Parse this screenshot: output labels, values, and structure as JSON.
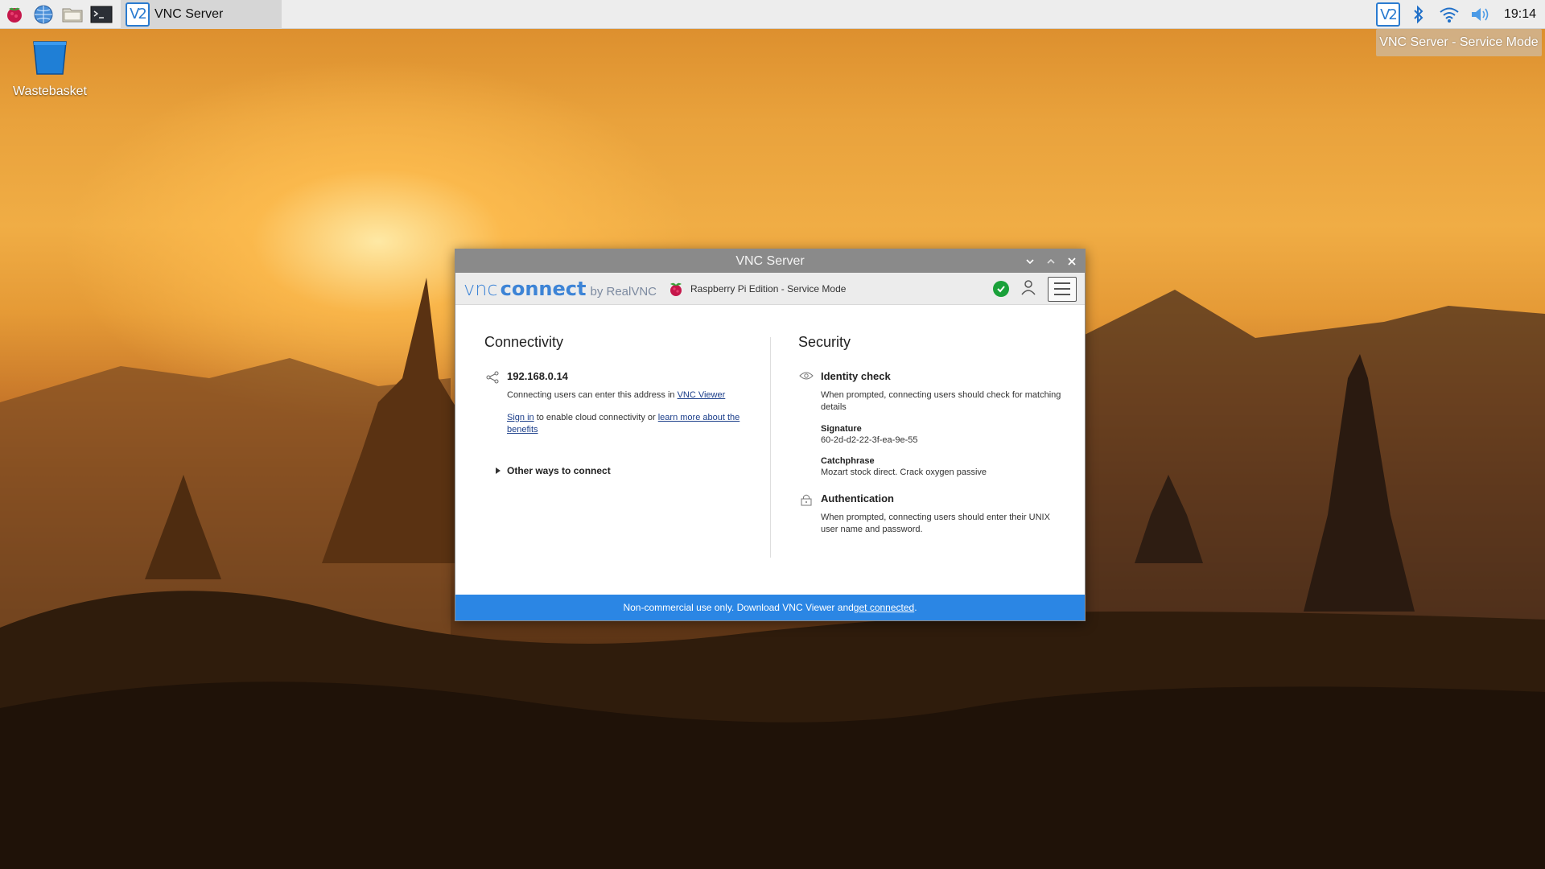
{
  "taskbar": {
    "task_title": "VNC Server",
    "clock": "19:14",
    "tray_tooltip": "VNC Server - Service Mode"
  },
  "desktop": {
    "icons": [
      {
        "label": "Wastebasket",
        "icon": "wastebasket-icon"
      }
    ]
  },
  "window": {
    "title": "VNC Server",
    "brand": {
      "vnc": "vnc",
      "connect": "connect",
      "by": "by RealVNC"
    },
    "edition": "Raspberry Pi Edition - Service Mode",
    "connectivity": {
      "title": "Connectivity",
      "address": "192.168.0.14",
      "address_note_prefix": "Connecting users can enter this address in ",
      "address_note_link": "VNC Viewer",
      "signin_link": "Sign in",
      "signin_middle": " to enable cloud connectivity or ",
      "learn_more_link": "learn more about the benefits",
      "other_ways": "Other ways to connect"
    },
    "security": {
      "title": "Security",
      "identity_title": "Identity check",
      "identity_text": "When prompted, connecting users should check for matching details",
      "signature_label": "Signature",
      "signature_value": "60-2d-d2-22-3f-ea-9e-55",
      "catchphrase_label": "Catchphrase",
      "catchphrase_value": "Mozart stock direct. Crack oxygen passive",
      "auth_title": "Authentication",
      "auth_text": "When prompted, connecting users should enter their UNIX user name and password."
    },
    "banner": {
      "text": "Non-commercial use only. Download VNC Viewer and ",
      "link": "get connected",
      "suffix": "."
    }
  },
  "colors": {
    "accent": "#2b86e4",
    "brand_blue": "#3d84d6",
    "status_ok": "#1aa13a",
    "titlebar": "#8a8a8a"
  }
}
